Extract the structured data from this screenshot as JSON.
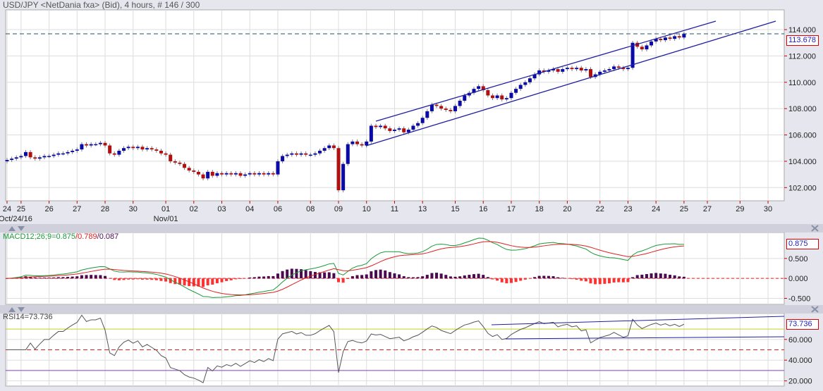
{
  "title": "USD/JPY <NetDania fxa> (Bid), 4 hours, # 146 / 300",
  "colors": {
    "up": "#0a0aa8",
    "down": "#b01010",
    "macd": "#1a9a3a",
    "signal": "#e02020",
    "hist_pos": "#4a0a50",
    "hist_neg": "#ff3030",
    "trend": "#2020a0"
  },
  "chart_data": [
    {
      "type": "candlestick",
      "name": "price",
      "ylim": [
        101,
        115.5
      ],
      "yticks": [
        "102.000",
        "104.000",
        "106.000",
        "108.000",
        "110.000",
        "112.000",
        "114.000"
      ],
      "ytick_values": [
        102,
        104,
        106,
        108,
        110,
        112,
        114
      ],
      "last_price": "113.678",
      "xtick_labels": [
        "24",
        "25",
        "26",
        "27",
        "28",
        "30",
        "01",
        "02",
        "03",
        "04",
        "06",
        "08",
        "09",
        "10",
        "11",
        "13",
        "15",
        "16",
        "17",
        "18",
        "20",
        "22",
        "23",
        "24",
        "25",
        "27",
        "29",
        "30"
      ],
      "xtick_bars": [
        0,
        3,
        9,
        15,
        21,
        27,
        34,
        40,
        46,
        52,
        58,
        65,
        71,
        77,
        83,
        89,
        96,
        102,
        108,
        114,
        120,
        127,
        133,
        139,
        145,
        150,
        157,
        163
      ],
      "date_labels": [
        {
          "text": "Oct/24/16",
          "bar": 0
        },
        {
          "text": "Nov/01",
          "bar": 34
        }
      ],
      "closes": [
        104.1,
        104.2,
        104.3,
        104.4,
        104.7,
        104.3,
        104.2,
        104.3,
        104.4,
        104.4,
        104.5,
        104.6,
        104.6,
        104.7,
        104.8,
        104.9,
        105.3,
        105.2,
        105.3,
        105.3,
        105.4,
        105.2,
        104.6,
        104.5,
        104.8,
        105.0,
        105.1,
        105.0,
        105.1,
        104.9,
        105.0,
        104.9,
        104.8,
        104.6,
        104.5,
        104.0,
        103.9,
        103.8,
        103.5,
        103.3,
        103.2,
        103.0,
        102.7,
        103.2,
        102.9,
        103.1,
        103.0,
        103.1,
        103.0,
        103.1,
        102.9,
        103.0,
        103.1,
        103.0,
        103.1,
        103.0,
        103.1,
        103.0,
        104.0,
        104.4,
        104.5,
        104.6,
        104.5,
        104.6,
        104.5,
        104.5,
        104.6,
        104.8,
        105.0,
        105.2,
        105.0,
        101.8,
        103.8,
        105.3,
        105.5,
        105.3,
        105.2,
        105.5,
        106.7,
        106.6,
        106.7,
        106.5,
        106.3,
        106.4,
        106.5,
        106.2,
        106.4,
        106.7,
        106.9,
        107.3,
        107.8,
        108.3,
        108.2,
        108.0,
        107.9,
        107.8,
        108.2,
        108.6,
        109.0,
        109.2,
        109.5,
        109.7,
        109.4,
        109.0,
        108.8,
        109.0,
        108.7,
        108.8,
        109.2,
        109.5,
        109.8,
        110.0,
        110.3,
        110.6,
        110.9,
        110.8,
        110.9,
        111.0,
        110.8,
        111.0,
        111.1,
        111.0,
        111.1,
        110.9,
        111.0,
        110.4,
        110.6,
        110.8,
        110.9,
        111.0,
        111.2,
        111.1,
        111.0,
        111.1,
        113.0,
        112.7,
        112.5,
        112.8,
        113.1,
        113.3,
        113.2,
        113.4,
        113.3,
        113.5,
        113.4,
        113.678
      ]
    },
    {
      "type": "line",
      "name": "MACD",
      "label": "MACD12;26;9=",
      "values_text": [
        "0.875",
        "0.789",
        "0.087"
      ],
      "last": "0.875",
      "yticks": [
        "0.500",
        "0.000",
        "-0.500"
      ],
      "ytick_values": [
        0.5,
        0,
        -0.5
      ],
      "ylim": [
        -0.65,
        1.15
      ]
    },
    {
      "type": "line",
      "name": "RSI",
      "label": "RSI14=73.736",
      "last": "73.736",
      "yticks": [
        "60.000",
        "40.000",
        "20.000"
      ],
      "ytick_values": [
        60,
        40,
        20
      ],
      "ylim": [
        15,
        85
      ],
      "levels": [
        70,
        50,
        30
      ]
    }
  ]
}
